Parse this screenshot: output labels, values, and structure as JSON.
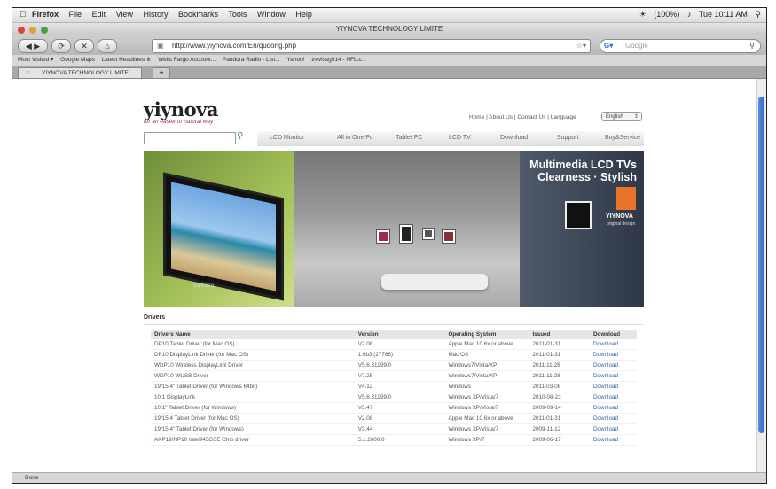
{
  "menubar": {
    "app": "Firefox",
    "menus": [
      "File",
      "Edit",
      "View",
      "History",
      "Bookmarks",
      "Tools",
      "Window",
      "Help"
    ],
    "clock": "Tue 10:11 AM",
    "battery": "(100%)"
  },
  "window": {
    "title": "YIYNOVA TECHNOLOGY LIMITE"
  },
  "toolbar": {
    "url": "http://www.yiynova.com/En/qudong.php",
    "search_placeholder": "Google"
  },
  "bookmarks": [
    "Most Visited ▾",
    "Google Maps",
    "Latest Headlines ⋔",
    "Wells Fargo Account...",
    "Pandora Radio - List...",
    "Yahoo!",
    "trevissg914 - NFL.c..."
  ],
  "tab": {
    "label": "YIYNOVA TECHNOLOGY LIMITE"
  },
  "status": "Done",
  "site": {
    "logo": "yiynova",
    "tagline": "for an easier to natural way",
    "toplinks": "Home | About Us | Contact Us | Language",
    "language": "English",
    "nav": [
      "LCD Monitor",
      "All in One Pc",
      "Tablet PC",
      "LCD TV",
      "Download",
      "Support",
      "Buy&Service"
    ],
    "banner": {
      "headline1": "Multimedia LCD TVs",
      "headline2": "Clearness · Stylish",
      "brand": "YIYNOVA",
      "brand_sub": "original design",
      "tv_brand": "yiynova"
    },
    "section_title": "Drivers",
    "table": {
      "headers": [
        "Drivers Name",
        "Version",
        "Operating System",
        "Issued",
        "Download"
      ],
      "rows": [
        [
          "DP10 Tablet Driver (for Mac OS)",
          "V2.08",
          "Apple Mac 10.6x or above",
          "2011-01-31",
          "Download"
        ],
        [
          "DP10 DisplayLink Driver (for Mac OS)",
          "1.6b3 (27768)",
          "Mac OS",
          "2011-01-31",
          "Download"
        ],
        [
          "WDP10 Wireless DisplayLink Driver",
          "V5.6.31299.0",
          "Windows7/Vista/XP",
          "2011-11-28",
          "Download"
        ],
        [
          "WDP10 WUSB Driver",
          "V7.25",
          "Windows7/Vista/XP",
          "2011-11-28",
          "Download"
        ],
        [
          "19/15.4\" Tablet Driver (for Windows 64bit)",
          "V4.12",
          "Windows",
          "2011-03-08",
          "Download"
        ],
        [
          "10.1 DisplayLink",
          "V5.6.31299.0",
          "Windows XP/Vista/7",
          "2010-08-23",
          "Download"
        ],
        [
          "10.1\" Tablet Driver (for Windows)",
          "V3.47",
          "Windows XP/Vista/7",
          "2009-09-14",
          "Download"
        ],
        [
          "19/15.4 Tablet Driver (for Mac OS)",
          "V2.08",
          "Apple Mac 10.6x or above",
          "2011-01-31",
          "Download"
        ],
        [
          "19/15.4\" Tablet Driver (for Windows)",
          "V3.44",
          "Windows XP/Vista/7",
          "2009-11-12",
          "Download"
        ],
        [
          "AKP19/NP10 Intel945GSE Chip driver",
          "5.1.2600.0",
          "Windows XP/7",
          "2009-06-17",
          "Download"
        ]
      ]
    }
  }
}
